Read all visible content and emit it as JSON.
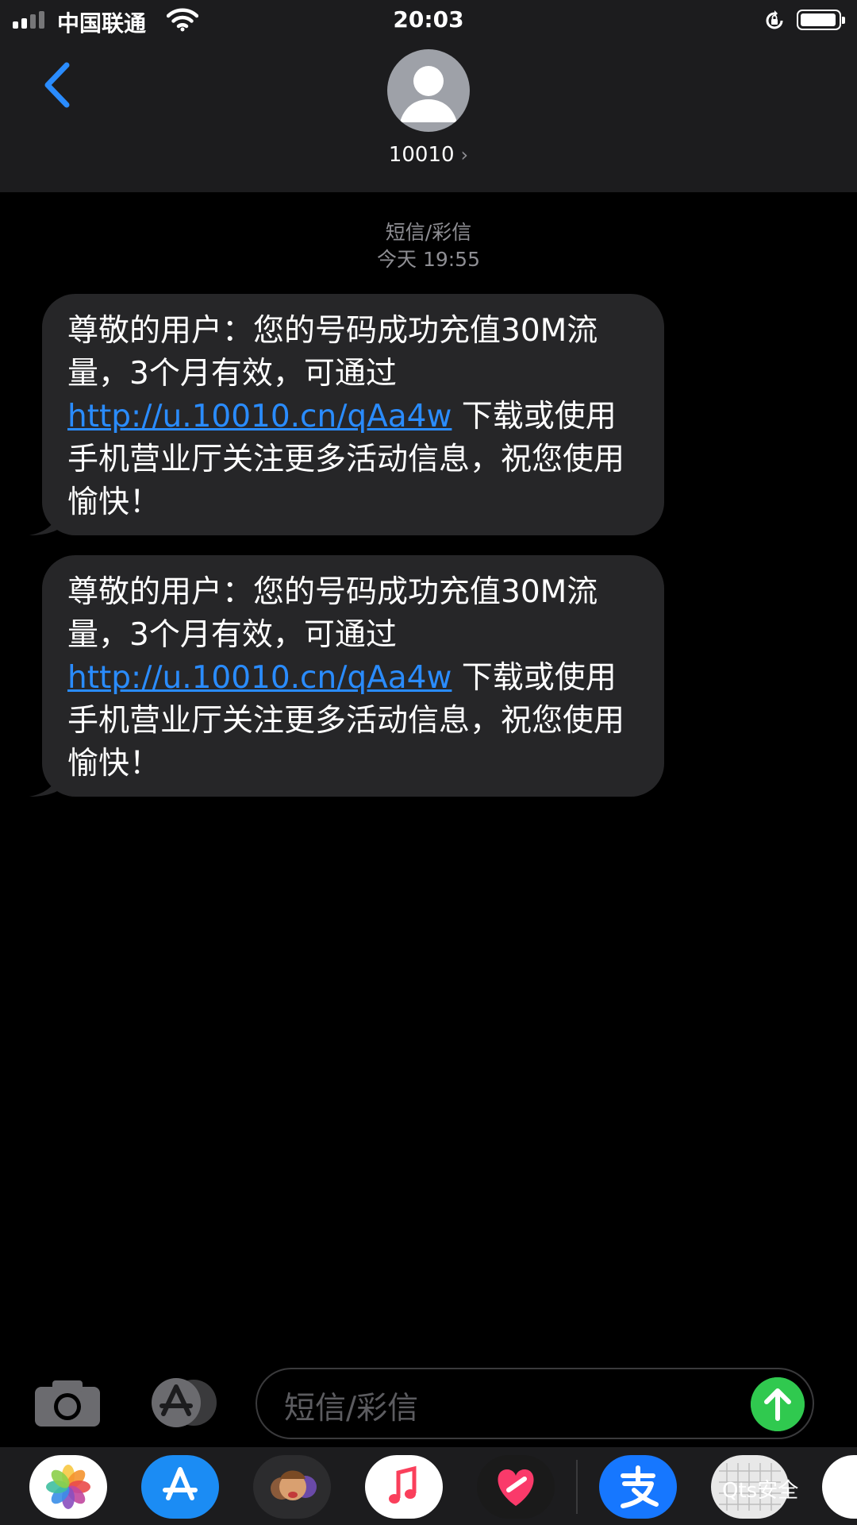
{
  "status_bar": {
    "carrier": "中国联通",
    "time": "20:03",
    "battery_level": 0.95
  },
  "header": {
    "contact_name": "10010",
    "chevron": "›"
  },
  "thread": {
    "service_label": "短信/彩信",
    "timestamp": "今天 19:55",
    "messages": [
      {
        "text_before": "尊敬的用户：您的号码成功充值30M流量，3个月有效，可通过",
        "link": "http://u.10010.cn/qAa4w",
        "text_after": " 下载或使用手机营业厅关注更多活动信息，祝您使用愉快！"
      },
      {
        "text_before": "尊敬的用户：您的号码成功充值30M流量，3个月有效，可通过",
        "link": "http://u.10010.cn/qAa4w",
        "text_after": " 下载或使用手机营业厅关注更多活动信息，祝您使用愉快！"
      }
    ]
  },
  "composer": {
    "placeholder": "短信/彩信"
  },
  "dock": {
    "watermark": "Qts安全"
  },
  "colors": {
    "accent_blue": "#2a8cff",
    "send_green": "#30c94f",
    "bubble": "#262628",
    "bar": "#1c1c1e"
  },
  "icons": {
    "back": "chevron-left-icon",
    "camera": "camera-icon",
    "app_store": "app-store-icon",
    "send": "arrow-up-icon"
  }
}
